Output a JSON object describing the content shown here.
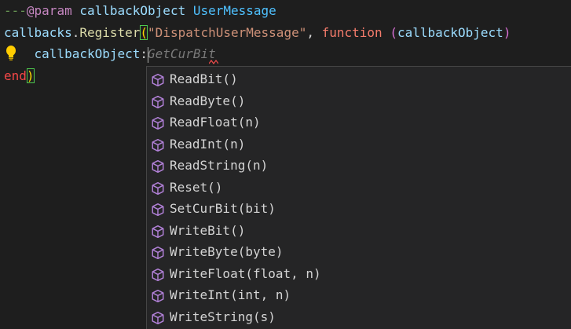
{
  "editor": {
    "line1": {
      "comment_prefix": "---",
      "annotation": "@param",
      "param_name": "callbackObject",
      "param_type": "UserMessage"
    },
    "line2": {
      "object": "callbacks",
      "dot": ".",
      "method": "Register",
      "open_paren": "(",
      "string": "\"DispatchUserMessage\"",
      "comma": ", ",
      "keyword": "function",
      "space": " ",
      "inner_open": "(",
      "arg": "callbackObject",
      "inner_close": ")"
    },
    "line3": {
      "indent": "  ",
      "object": "callbackObject",
      "colon": ":",
      "ghost_text": "GetCurBit"
    },
    "line4": {
      "keyword": "end",
      "close_paren": ")"
    }
  },
  "suggestions": {
    "icon": "method-cube-icon",
    "items": [
      "ReadBit()",
      "ReadByte()",
      "ReadFloat(n)",
      "ReadInt(n)",
      "ReadString(n)",
      "Reset()",
      "SetCurBit(bit)",
      "WriteBit()",
      "WriteByte(byte)",
      "WriteFloat(float, n)",
      "WriteInt(int, n)",
      "WriteString(s)"
    ]
  },
  "colors": {
    "background": "#1e1e1e",
    "suggest_background": "#252526",
    "method_icon": "#b180d7",
    "lightbulb": "#ffcc00"
  }
}
